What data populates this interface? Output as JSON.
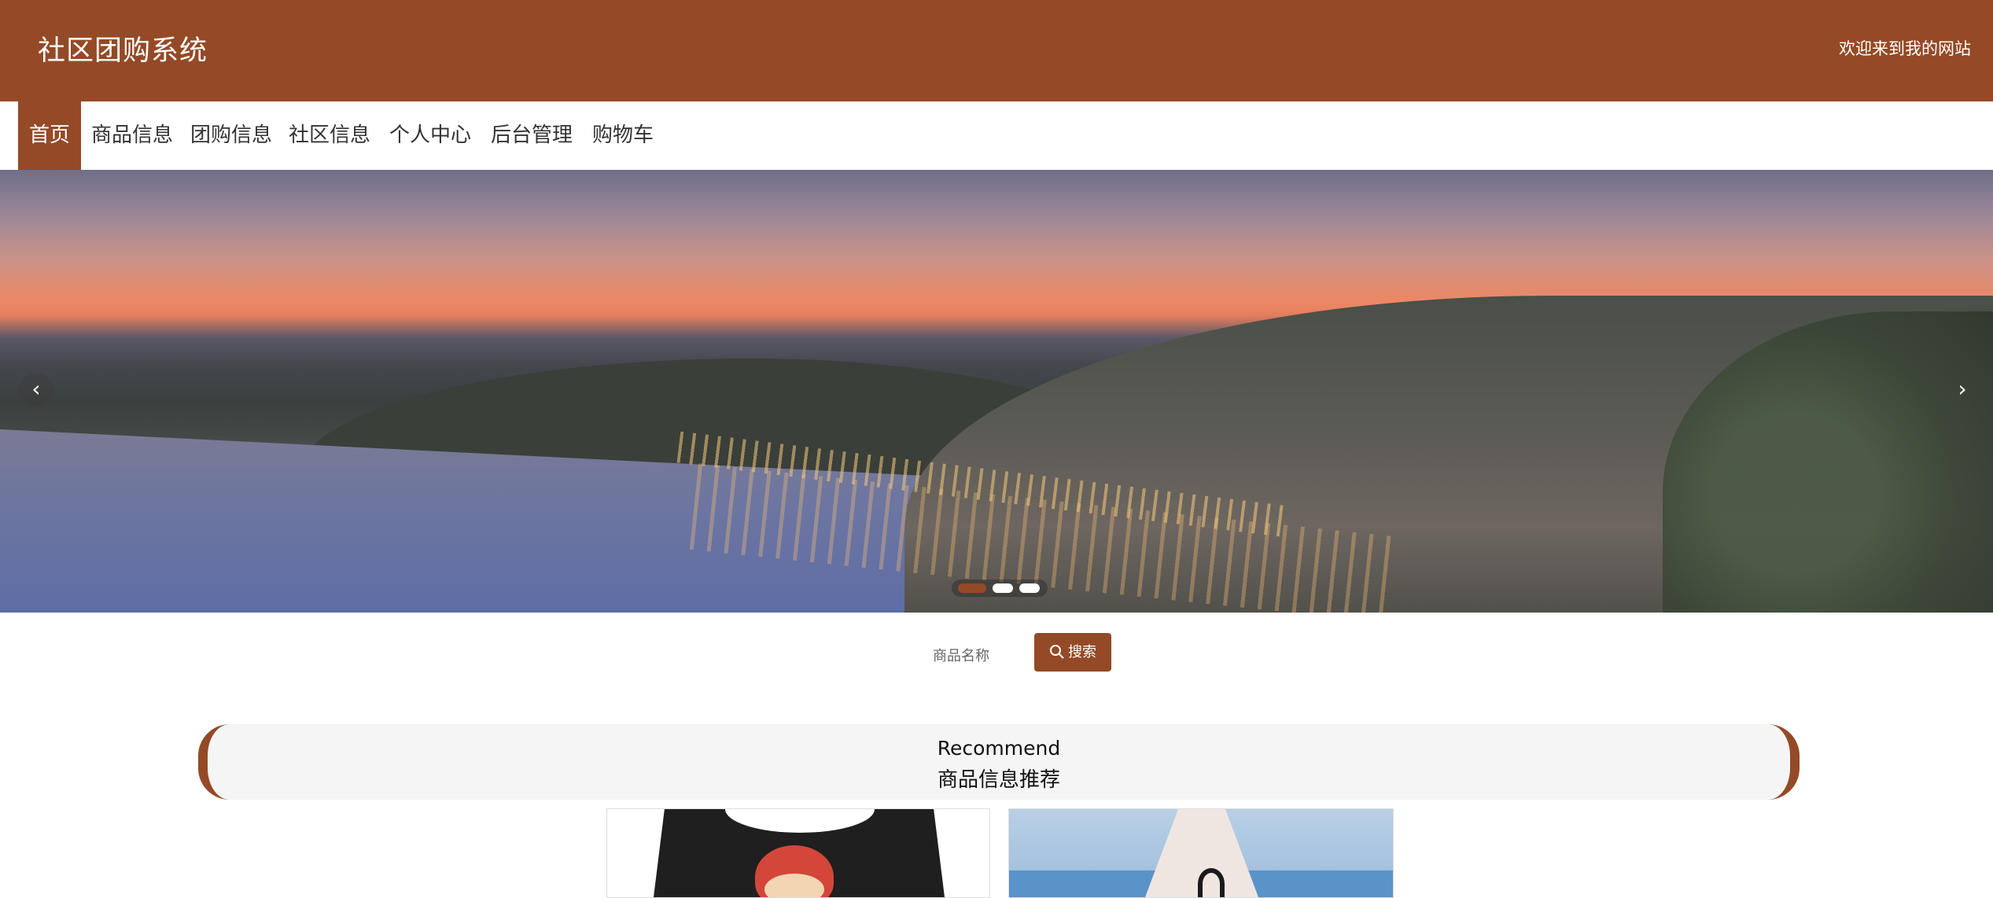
{
  "header": {
    "site_title": "社区团购系统",
    "welcome_text": "欢迎来到我的网站"
  },
  "nav": {
    "items": [
      {
        "label": "首页",
        "active": true
      },
      {
        "label": "商品信息"
      },
      {
        "label": "团购信息"
      },
      {
        "label": "社区信息"
      },
      {
        "label": "个人中心"
      },
      {
        "label": "后台管理"
      },
      {
        "label": "购物车"
      }
    ]
  },
  "banner": {
    "prev_icon": "chevron-left-icon",
    "next_icon": "chevron-right-icon",
    "prev_glyph": "‹",
    "next_glyph": "›",
    "slide_count": 3,
    "active_slide": 1
  },
  "search": {
    "placeholder": "商品名称",
    "button_label": "搜索",
    "button_icon": "search-icon"
  },
  "recommend": {
    "title_en": "Recommend",
    "title_cn": "商品信息推荐"
  },
  "colors": {
    "brand": "#944a26",
    "header_text": "#ffffff",
    "nav_text": "#333333",
    "panel_bg": "#f5f5f5"
  }
}
